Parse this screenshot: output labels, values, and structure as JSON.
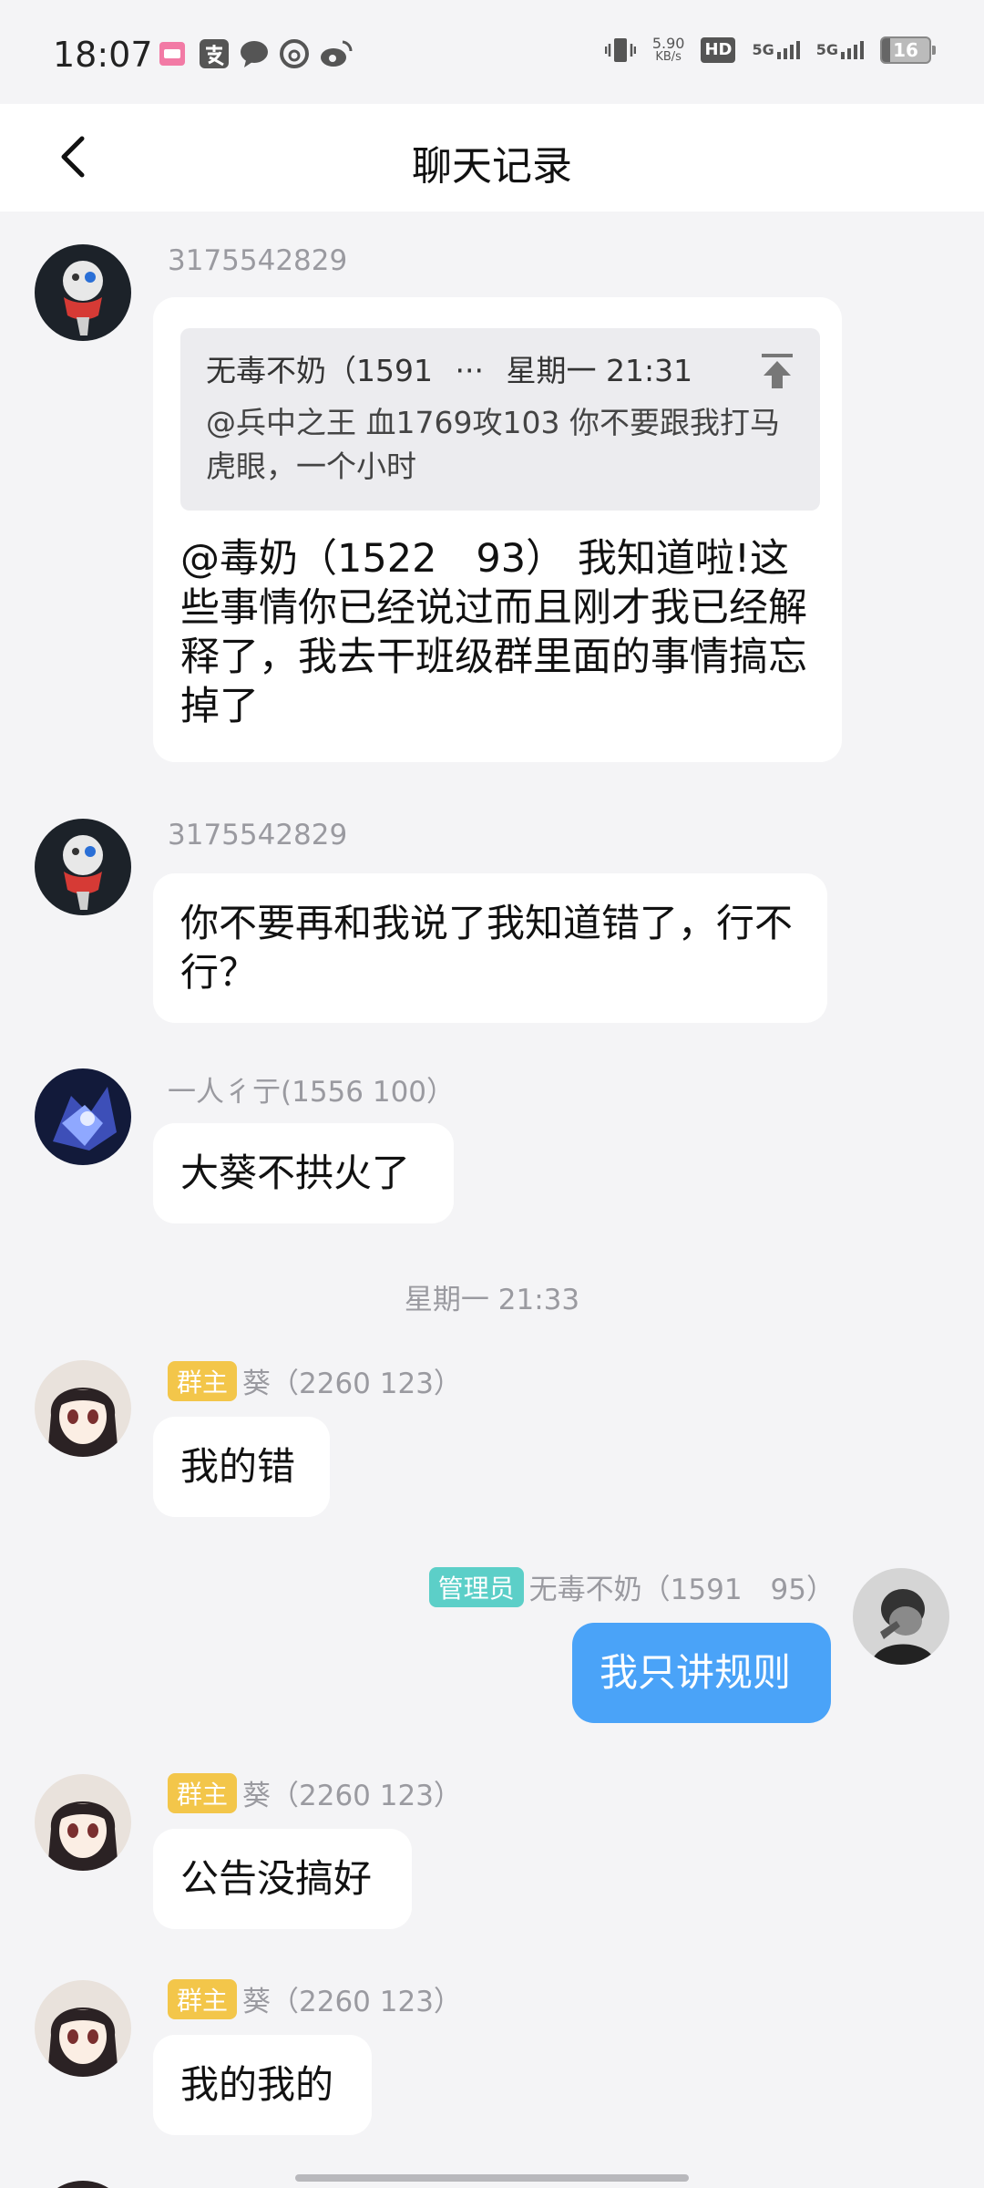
{
  "status_bar": {
    "time": "18:07",
    "net_speed_value": "5.90",
    "net_speed_unit": "KB/s",
    "hd_label": "HD",
    "sim1_label": "5G",
    "sim2_label": "5G",
    "battery": "16",
    "icons": [
      "app-pink-icon",
      "alipay-icon",
      "chat-icon",
      "netease-music-icon",
      "weibo-icon",
      "vibrate-icon",
      "hd-icon",
      "signal-icon",
      "battery-icon"
    ]
  },
  "navbar": {
    "title": "聊天记录",
    "back_icon": "chevron-left-icon"
  },
  "messages": [
    {
      "sender": "3175542829",
      "quote": {
        "author": "无毒不奶（1591",
        "ellipsis": "···",
        "time": "星期一 21:31",
        "text": "@兵中之王 血1769攻103 你不要跟我打马虎眼，一个小时"
      },
      "text": "@毒奶（1522　93） 我知道啦!这些事情你已经说过而且刚才我已经解释了，我去干班级群里面的事情搞忘掉了"
    },
    {
      "sender": "3175542829",
      "text": "你不要再和我说了我知道错了，行不行？"
    },
    {
      "sender": "一人彳亍(1556  100）",
      "text": "大葵不拱火了"
    },
    {
      "badge": "群主",
      "sender": "葵（2260 123）",
      "text": "我的错"
    },
    {
      "badge": "管理员",
      "sender": "无毒不奶（1591　95）",
      "text": "我只讲规则"
    },
    {
      "badge": "群主",
      "sender": "葵（2260 123）",
      "text": "公告没搞好"
    },
    {
      "badge": "群主",
      "sender": "葵（2260 123）",
      "text": "我的我的"
    }
  ],
  "timestamp": "星期一 21:33",
  "colors": {
    "background": "#f4f4f6",
    "self_bubble": "#4aa3f8",
    "owner_badge": "#f3c64a",
    "admin_badge": "#5ccfc8"
  }
}
